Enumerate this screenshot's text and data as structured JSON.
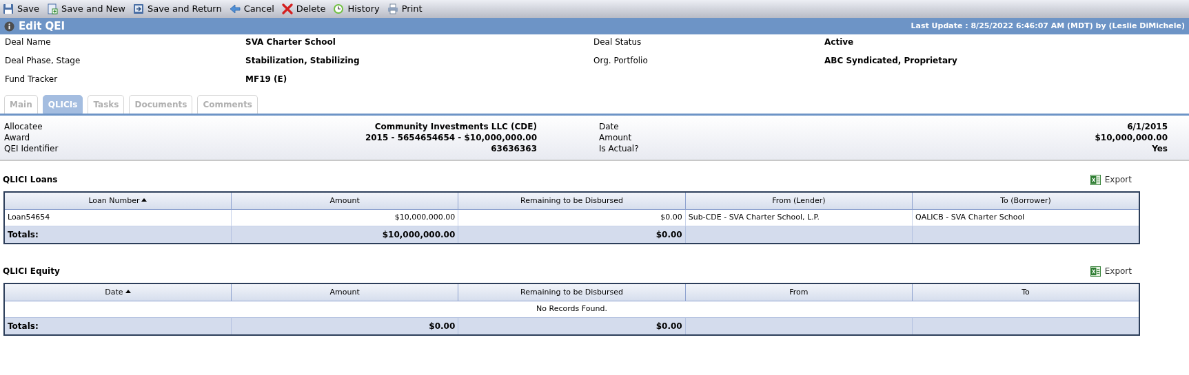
{
  "toolbar": [
    {
      "kind": "save",
      "label": "Save"
    },
    {
      "kind": "save-new",
      "label": "Save and New"
    },
    {
      "kind": "save-return",
      "label": "Save and Return"
    },
    {
      "kind": "cancel",
      "label": "Cancel"
    },
    {
      "kind": "delete",
      "label": "Delete"
    },
    {
      "kind": "history",
      "label": "History"
    },
    {
      "kind": "print",
      "label": "Print"
    }
  ],
  "header": {
    "title": "Edit QEI",
    "last_update": "Last Update : 8/25/2022 6:46:07 AM (MDT) by (Leslie DiMichele)"
  },
  "fields": [
    {
      "label": "Deal Name",
      "value": "SVA Charter School"
    },
    {
      "label": "Deal Status",
      "value": "Active"
    },
    {
      "label": "Deal Phase, Stage",
      "value": "Stabilization, Stabilizing"
    },
    {
      "label": "Org. Portfolio",
      "value": "ABC Syndicated, Proprietary"
    },
    {
      "label": "Fund Tracker",
      "value": "MF19 (E)"
    }
  ],
  "tabs": [
    {
      "label": "Main",
      "selected": false
    },
    {
      "label": "QLICIs",
      "selected": true
    },
    {
      "label": "Tasks",
      "selected": false
    },
    {
      "label": "Documents",
      "selected": false
    },
    {
      "label": "Comments",
      "selected": false
    }
  ],
  "summary": {
    "left": [
      {
        "label": "Allocatee",
        "value": "Community Investments LLC (CDE)"
      },
      {
        "label": "Award",
        "value": "2015 - 5654654654 - $10,000,000.00"
      },
      {
        "label": "QEI Identifier",
        "value": "63636363"
      }
    ],
    "right": [
      {
        "label": "Date",
        "value": "6/1/2015"
      },
      {
        "label": "Amount",
        "value": "$10,000,000.00"
      },
      {
        "label": "Is Actual?",
        "value": "Yes"
      }
    ]
  },
  "grids": [
    {
      "title": "QLICI Loans",
      "export": "Export",
      "columns": [
        {
          "label": "Loan Number",
          "sorted": true
        },
        {
          "label": "Amount",
          "sorted": false
        },
        {
          "label": "Remaining to be Disbursed",
          "sorted": false
        },
        {
          "label": "From (Lender)",
          "sorted": false
        },
        {
          "label": "To (Borrower)",
          "sorted": false
        }
      ],
      "rows": [
        [
          "Loan54654",
          "$10,000,000.00",
          "$0.00",
          "Sub-CDE - SVA Charter School, L.P.",
          "QALICB - SVA Charter School"
        ]
      ],
      "totals": {
        "label": "Totals:",
        "amount": "$10,000,000.00",
        "remaining": "$0.00"
      }
    },
    {
      "title": "QLICI Equity",
      "export": "Export",
      "columns": [
        {
          "label": "Date",
          "sorted": true
        },
        {
          "label": "Amount",
          "sorted": false
        },
        {
          "label": "Remaining to be Disbursed",
          "sorted": false
        },
        {
          "label": "From",
          "sorted": false
        },
        {
          "label": "To",
          "sorted": false
        }
      ],
      "empty": "No Records Found.",
      "totals": {
        "label": "Totals:",
        "amount": "$0.00",
        "remaining": "$0.00"
      }
    }
  ]
}
